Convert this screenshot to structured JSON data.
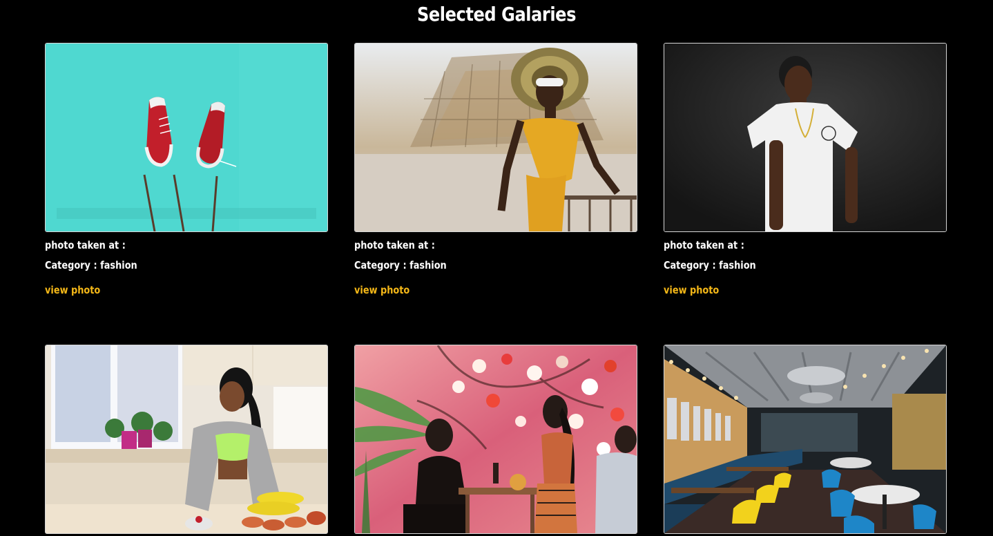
{
  "page": {
    "title": "Selected Galaries"
  },
  "colors": {
    "background": "#000000",
    "text": "#ffffff",
    "link": "#f5b818"
  },
  "gallery": [
    {
      "photo_taken_label": "photo taken at :",
      "category_label": "Category : fashion",
      "view_label": "view photo",
      "image_subject": "red sneakers on sticks against turquoise sky"
    },
    {
      "photo_taken_label": "photo taken at :",
      "category_label": "Category : fashion",
      "view_label": "view photo",
      "image_subject": "woman in yellow jumpsuit and wide hat"
    },
    {
      "photo_taken_label": "photo taken at :",
      "category_label": "Category : fashion",
      "view_label": "view photo",
      "image_subject": "man in white t-shirt on dark background"
    },
    {
      "image_subject": "woman cutting vegetables in kitchen"
    },
    {
      "image_subject": "two women at table before floral mural"
    },
    {
      "image_subject": "restaurant interior with yellow and blue chairs"
    }
  ]
}
